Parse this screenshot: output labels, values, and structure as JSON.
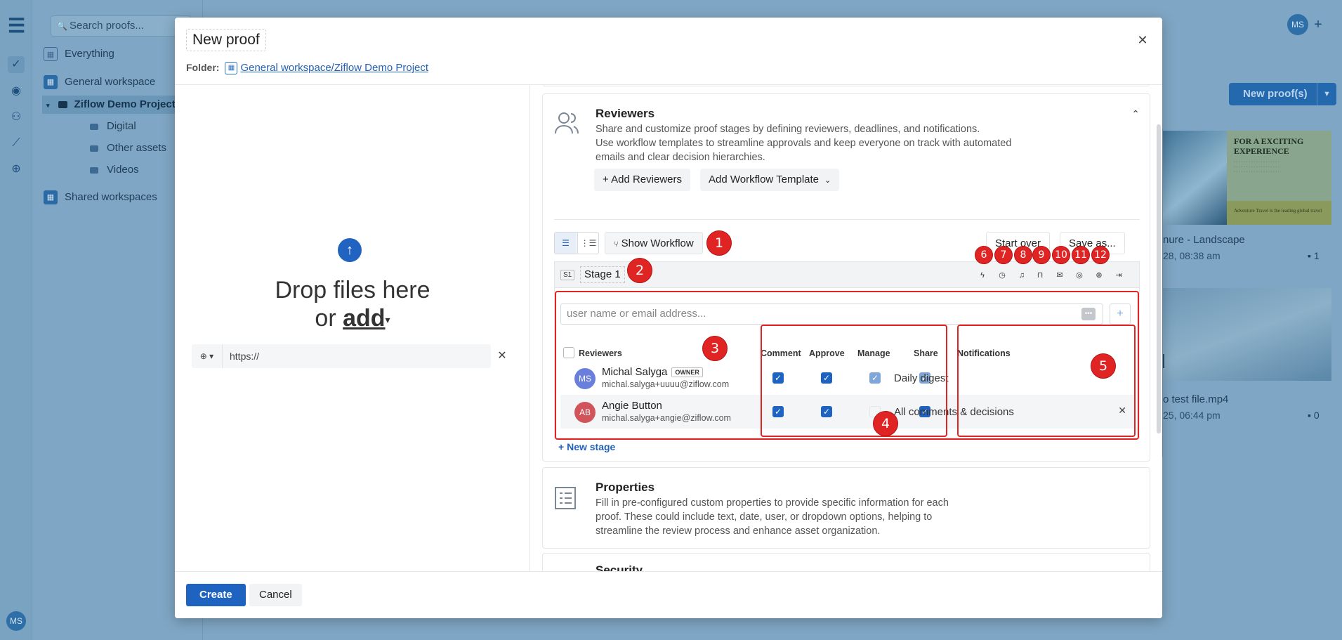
{
  "background": {
    "search_placeholder": "Search proofs...",
    "nav": {
      "everything": "Everything",
      "general_workspace": "General workspace",
      "project": "Ziflow Demo Project",
      "folders": [
        "Digital",
        "Other assets",
        "Videos"
      ],
      "shared_workspaces": "Shared workspaces"
    },
    "user_initials": "MS",
    "new_proofs_label": "New proof(s)",
    "cards": [
      {
        "title": "nure - Landscape",
        "meta": "28, 08:38 am",
        "comments": "1",
        "thumb_heading": "FOR A EXCITING EXPERIENCE",
        "thumb_footer": "Adventure Travel is the leading global travel"
      },
      {
        "title": "o test file.mp4",
        "meta": "25, 06:44 pm",
        "comments": "0",
        "badge": "0"
      }
    ]
  },
  "modal": {
    "title": "New proof",
    "folder_label": "Folder:",
    "folder_path": "General workspace/Ziflow Demo Project",
    "drop_line1": "Drop files here",
    "drop_or": "or",
    "drop_add": "add",
    "url_value": "https://",
    "reviewers_section": {
      "title": "Reviewers",
      "desc_line1": "Share and customize proof stages by defining reviewers, deadlines, and notifications.",
      "desc_line2": "Use workflow templates to streamline approvals and keep everyone on track with automated emails and clear decision hierarchies.",
      "add_reviewers": "Add Reviewers",
      "add_template": "Add Workflow Template",
      "show_workflow": "Show Workflow",
      "start_over": "Start over",
      "save_as": "Save as...",
      "stage_badge": "S1",
      "stage_name": "Stage 1",
      "input_placeholder": "user name or email address...",
      "columns": [
        "Reviewers",
        "Comment",
        "Approve",
        "Manage",
        "Share",
        "Notifications"
      ],
      "reviewers": [
        {
          "initials": "AB",
          "name": "Angie Button",
          "email": "michal.salyga+angie@ziflow.com",
          "notification": "All comments & decisions",
          "avatar_color": "#d0545a",
          "comment": true,
          "approve": true,
          "manage": false,
          "share": true
        }
      ],
      "owner": {
        "initials": "MS",
        "name": "Michal Salyga",
        "badge": "OWNER",
        "email": "michal.salyga+uuuu@ziflow.com",
        "notification": "Daily digest",
        "avatar_color": "#6a7fdc"
      },
      "new_stage": "New stage"
    },
    "properties_section": {
      "title": "Properties",
      "desc": "Fill in pre-configured custom properties to provide specific information for each proof. These could include text, date, user, or dropdown options, helping to streamline the review process and enhance asset organization."
    },
    "next_section_partial": "Security",
    "create_label": "Create",
    "cancel_label": "Cancel"
  },
  "annotations": [
    "1",
    "2",
    "3",
    "4",
    "5",
    "6",
    "7",
    "8",
    "9",
    "10",
    "11",
    "12"
  ]
}
